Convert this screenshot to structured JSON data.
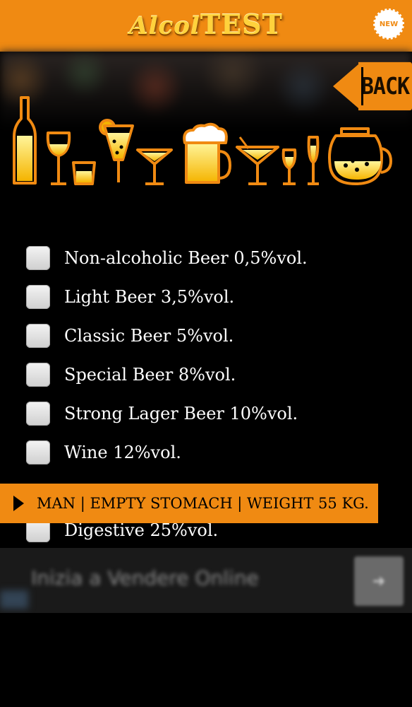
{
  "header": {
    "logo_part1": "Alcol",
    "logo_part2": "TEST",
    "new_badge": "NEW"
  },
  "back_button": {
    "label": "BACK"
  },
  "drinks": {
    "icons": [
      "bottle-icon",
      "wine-glass-icon",
      "shot-glass-icon",
      "cocktail-icon",
      "martini-glass-icon",
      "beer-mug-icon",
      "cocktail-glass-icon",
      "small-glass-icon",
      "flute-icon",
      "jug-icon"
    ]
  },
  "drink_list": [
    {
      "label": "Non-alcoholic Beer 0,5%vol.",
      "checked": false
    },
    {
      "label": "Light Beer 3,5%vol.",
      "checked": false
    },
    {
      "label": "Classic Beer 5%vol.",
      "checked": false
    },
    {
      "label": "Special Beer 8%vol.",
      "checked": false
    },
    {
      "label": "Strong Lager Beer 10%vol.",
      "checked": false
    },
    {
      "label": "Wine 12%vol.",
      "checked": false
    },
    {
      "label": "Digestive 25%vol.",
      "checked": false
    }
  ],
  "status_bar": {
    "text": "MAN | EMPTY STOMACH | WEIGHT 55 KG."
  },
  "ad": {
    "text": "Inizia a Vendere Online",
    "button_icon": "arrow-icon"
  },
  "colors": {
    "accent": "#f08a12",
    "logo": "#ffd23c",
    "background": "#000000"
  }
}
